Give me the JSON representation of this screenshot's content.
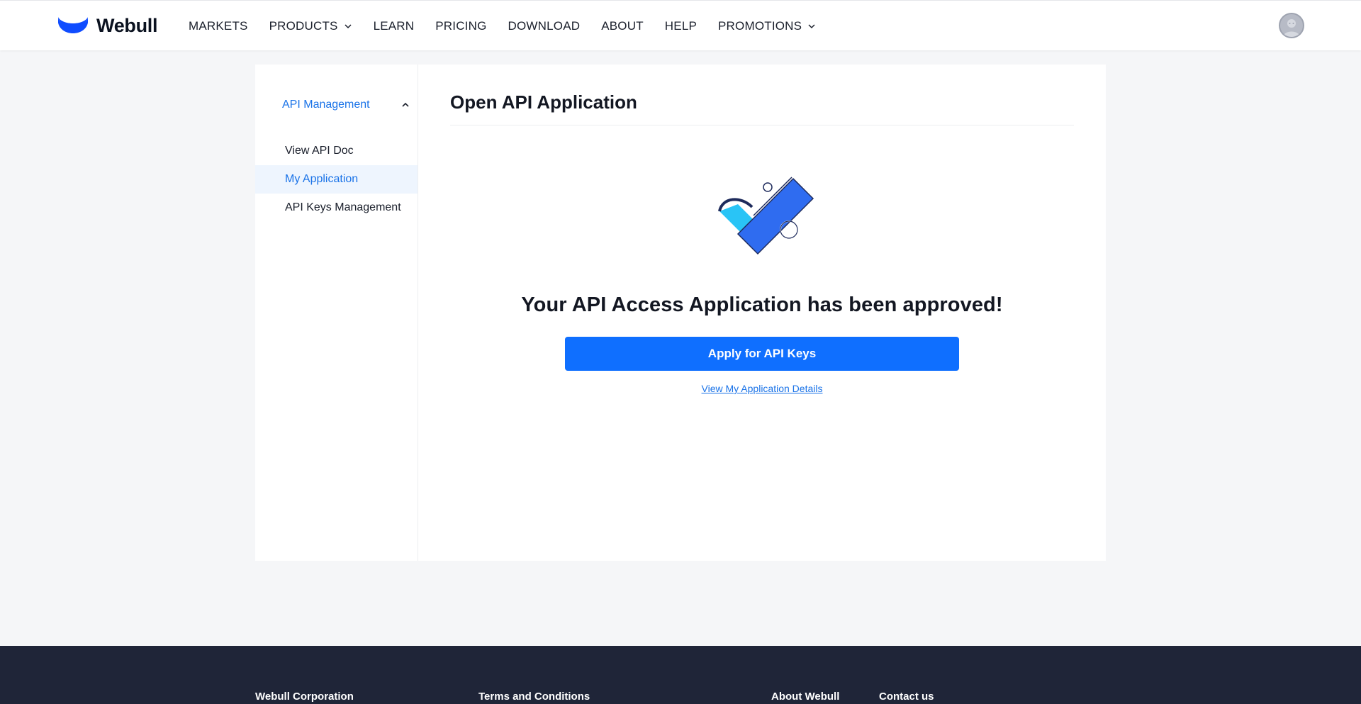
{
  "header": {
    "brand": "Webull",
    "nav": [
      {
        "label": "MARKETS",
        "dropdown": false
      },
      {
        "label": "PRODUCTS",
        "dropdown": true
      },
      {
        "label": "LEARN",
        "dropdown": false
      },
      {
        "label": "PRICING",
        "dropdown": false
      },
      {
        "label": "DOWNLOAD",
        "dropdown": false
      },
      {
        "label": "ABOUT",
        "dropdown": false
      },
      {
        "label": "HELP",
        "dropdown": false
      },
      {
        "label": "PROMOTIONS",
        "dropdown": true
      }
    ],
    "avatar_icon": "user-avatar-icon"
  },
  "sidebar": {
    "group_label": "API Management",
    "group_expanded": true,
    "items": [
      {
        "label": "View API Doc",
        "active": false
      },
      {
        "label": "My Application",
        "active": true
      },
      {
        "label": "API Keys Management",
        "active": false
      }
    ]
  },
  "main": {
    "title": "Open API Application",
    "illustration_icon": "approved-check-illustration",
    "message": "Your API Access Application has been approved!",
    "primary_button": "Apply for API Keys",
    "details_link": "View My Application Details"
  },
  "footer": {
    "columns": [
      "Webull Corporation",
      "Terms and Conditions",
      "About Webull",
      "Contact us"
    ]
  },
  "colors": {
    "accent": "#1a73e8",
    "button": "#0f6fff",
    "footer_bg": "#1f2538",
    "page_bg": "#f5f6f8",
    "active_item_bg": "#eef5fe"
  }
}
